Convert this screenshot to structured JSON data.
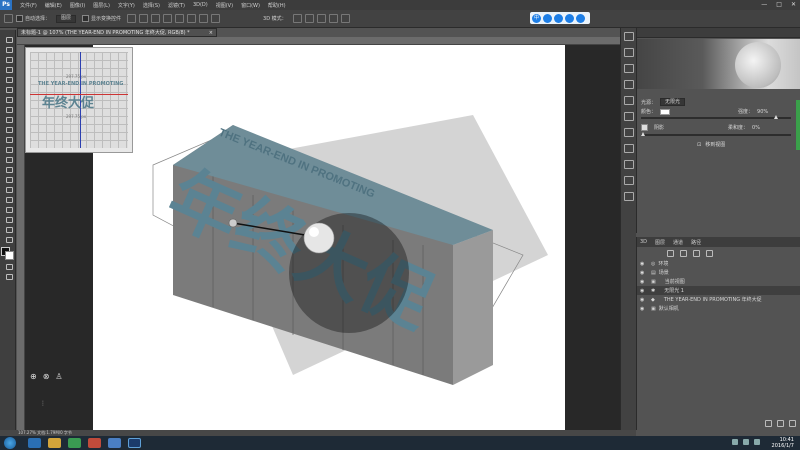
{
  "app": {
    "logo": "Ps"
  },
  "menubar": {
    "items": [
      "文件(F)",
      "编辑(E)",
      "图像(I)",
      "图层(L)",
      "文字(Y)",
      "选择(S)",
      "滤镜(T)",
      "3D(D)",
      "视图(V)",
      "窗口(W)",
      "帮助(H)"
    ],
    "window_controls": [
      "—",
      "□",
      "✕"
    ]
  },
  "options": {
    "auto_select_label": "自动选择：",
    "auto_select_value": "图层",
    "transform_label": "显示变换控件",
    "mode_label": "3D 模式："
  },
  "ime": {
    "logo": "中"
  },
  "document": {
    "tab_title": "未标题-1 @ 107% (THE YEAR-END IN PROMOTING 年终大促, RGB/8) *",
    "tab_close": "×"
  },
  "navigator": {
    "main_text": "年终大促",
    "sub_text": "THE YEAR-END IN PROMOTING",
    "caption_top": "297.75 px",
    "caption_bottom": "297.75 px"
  },
  "canvas_3d": {
    "main_text": "年终大促",
    "sub_text": "THE YEAR-END IN PROMOTING"
  },
  "properties": {
    "preset_label": "光源：",
    "preset_value": "无限光",
    "color_label": "颜色：",
    "intensity_label": "强度：",
    "intensity_value": "90%",
    "shadow_label": "阴影",
    "softness_label": "柔和度：",
    "softness_value": "0%",
    "edit_lens_label": "移到视图",
    "intensity_fraction": 0.9,
    "softness_fraction": 0.0
  },
  "scene": {
    "tabs": [
      "3D",
      "图层",
      "通道",
      "路径"
    ],
    "layers": [
      {
        "label": "环境",
        "selected": false,
        "icon": "globe-icon"
      },
      {
        "label": "场景",
        "selected": false,
        "icon": "scene-icon"
      },
      {
        "label": "当前视图",
        "selected": false,
        "icon": "camera-icon"
      },
      {
        "label": "无限光 1",
        "selected": true,
        "icon": "sun-icon"
      },
      {
        "label": "THE YEAR-END IN PROMOTING 年终大促",
        "selected": false,
        "icon": "mesh-icon"
      },
      {
        "label": "默认相机",
        "selected": false,
        "icon": "camera-icon"
      }
    ]
  },
  "status": {
    "text": "107.27%  文档:1.79M/0 字节"
  },
  "taskbar": {
    "time": "10:41",
    "date": "2016/1/7"
  },
  "colors": {
    "accent": "#5d8391",
    "canvas_bg": "#282828",
    "panel_bg": "#535353"
  }
}
